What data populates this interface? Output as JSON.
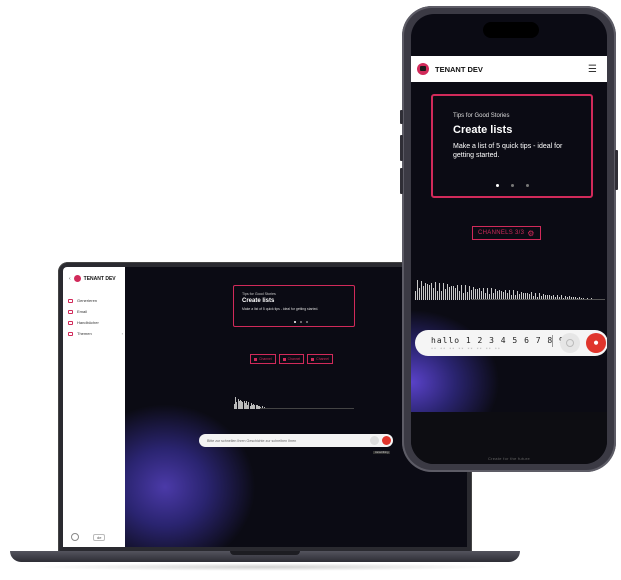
{
  "laptop": {
    "brand": "TENANT DEV",
    "nav_items": [
      {
        "label": "Generieren",
        "icon": "compose-icon"
      },
      {
        "label": "Email",
        "icon": "email-icon"
      },
      {
        "label": "Handbücher",
        "icon": "book-icon"
      },
      {
        "label": "Themen",
        "icon": "topic-icon"
      }
    ],
    "language": "de",
    "card": {
      "kicker": "Tips for Good Stories",
      "title": "Create lists",
      "text": "Make a list of 5 quick tips - ideal for getting started."
    },
    "chips": [
      {
        "label": "Channel"
      },
      {
        "label": "Channel"
      },
      {
        "label": "Channel"
      }
    ],
    "input_placeholder": "Bitte zur schnellen Ihren Geschichte zur schreiben Ihren",
    "tag": "transcribing"
  },
  "phone": {
    "brand": "TENANT DEV",
    "menu_icon": "hamburger-icon",
    "card": {
      "kicker": "Tips for Good Stories",
      "title": "Create lists",
      "text": "Make a list of 5 quick tips - ideal for getting started."
    },
    "carousel": {
      "total": 3,
      "active": 1
    },
    "channels_label": "CHANNELS 3/3",
    "input_text": "hallo 1 2 3 4 5 6 7 8 9",
    "input_sub": "** ** ** ** ** ** ** **",
    "bottom_text": "Create for the future"
  },
  "colors": {
    "accent": "#d12a5a",
    "mic": "#e0352c",
    "background_dark": "#0b0b14",
    "glow": "#4b3aa8"
  }
}
